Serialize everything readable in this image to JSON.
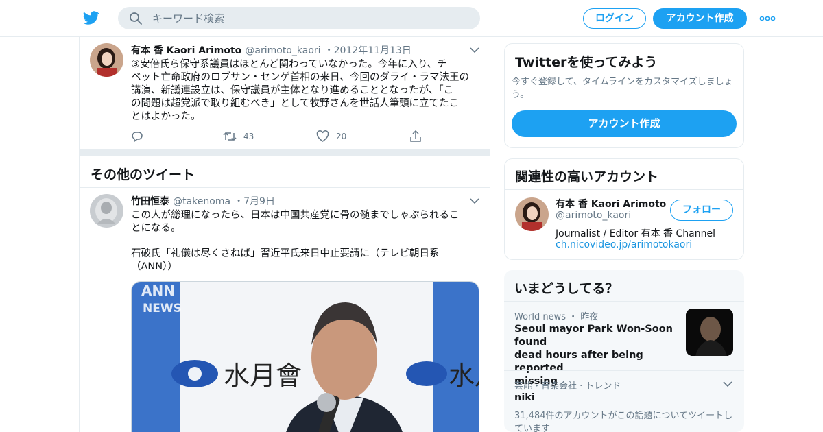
{
  "header": {
    "logo_icon": "twitter-bird-icon",
    "search_placeholder": "キーワード検索",
    "login_label": "ログイン",
    "signup_label": "アカウント作成",
    "more_icon": "more-dots-icon"
  },
  "colors": {
    "accent": "#1da1f2",
    "text": "#14171a",
    "muted": "#657786",
    "border": "#e6ecf0"
  },
  "tweet1": {
    "name": "有本 香 Kaori Arimoto",
    "handle": "@arimoto_kaori",
    "date": "・2012年11月13日",
    "lines": [
      "③安倍氏ら保守系議員はほとんど関わっていなかった。今年に入り、チ",
      "ベット亡命政府のロブサン・センゲ首相の来日、今回のダライ・ラマ法王の",
      "講演、新議連設立は、保守議員が主体となり進めることとなったが、「こ",
      "の問題は超党派で取り組むべき」として牧野さんを世話人筆頭に立てたこ",
      "とはよかった。"
    ],
    "retweets": "43",
    "likes": "20"
  },
  "more_tweets_title": "その他のツイート",
  "tweet2": {
    "name": "竹田恒泰",
    "handle": "@takenoma",
    "date": "・7月9日",
    "lines": [
      "この人が総理になったら、日本は中国共産党に骨の髄までしゃぶられるこ",
      "とになる。"
    ],
    "link_lines": [
      "石破氏「礼儀は尽くさねば」習近平氏来日中止要請に（テレビ朝日系",
      "（ANN））"
    ],
    "media": {
      "logo_top": "ANN",
      "logo_bottom": "NEWS",
      "sign_left": "水月會",
      "sign_right": "水月"
    }
  },
  "sidebar": {
    "try": {
      "title": "Twitterを使ってみよう",
      "desc_lines": [
        "今すぐ登録して、タイムラインをカスタマイズしましょ",
        "う。"
      ],
      "button": "アカウント作成"
    },
    "related": {
      "title": "関連性の高いアカウント",
      "name": "有本 香 Kaori Arimoto",
      "handle": "@arimoto_kaori",
      "follow": "フォロー",
      "bio": "Journalist / Editor 有本 香 Channel",
      "link": "ch.nicovideo.jp/arimotokaori"
    },
    "trends": {
      "title": "いまどうしてる？",
      "items": [
        {
          "meta": "World news ・ 昨夜",
          "lines": [
            "Seoul mayor Park Won-Soon found",
            "dead hours after being reported",
            "missing"
          ]
        },
        {
          "meta": "芸能・音楽会社 · トレンド",
          "name": "niki",
          "desc_lines": [
            "31,484件のアカウントがこの話題についてツイートし",
            "ています"
          ]
        }
      ]
    }
  }
}
